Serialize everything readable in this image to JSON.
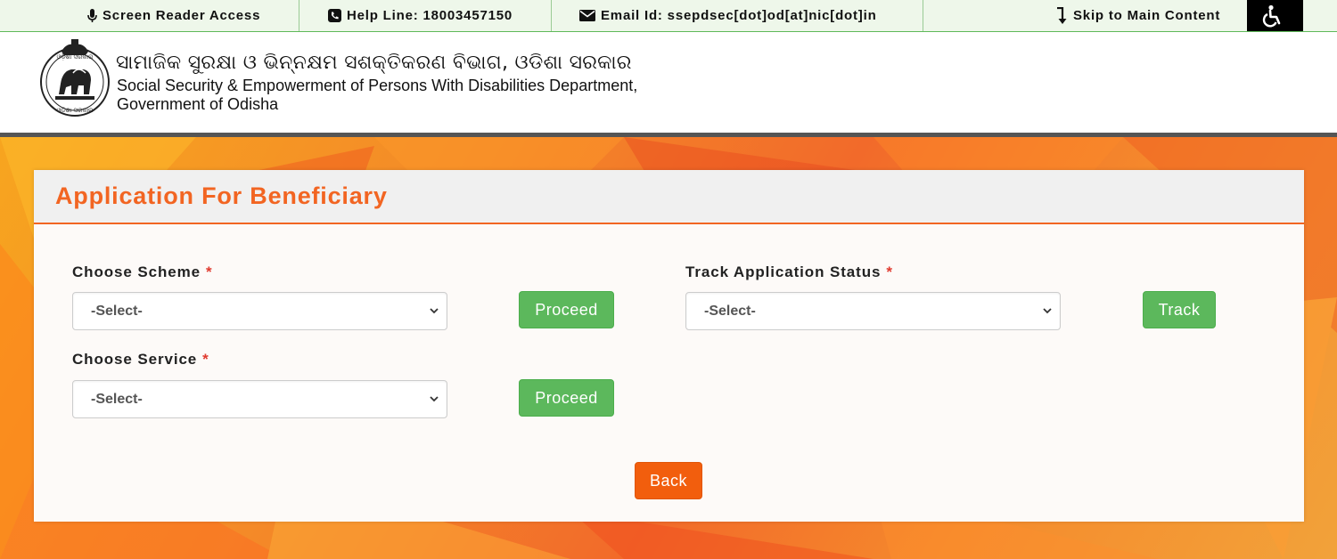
{
  "topbar": {
    "screen_reader": "Screen Reader Access",
    "helpline": "Help Line: 18003457150",
    "email": "Email Id: ssepdsec[dot]od[at]nic[dot]in",
    "skip": "Skip to Main Content",
    "icons": {
      "screen_reader": "microphone-icon",
      "helpline": "phone-icon",
      "email": "envelope-icon",
      "skip": "down-arrow-icon",
      "accessibility": "wheelchair-icon"
    }
  },
  "header": {
    "title_odia": "ସାମାଜିକ ସୁରକ୍ଷା ଓ ଭିନ୍ନକ୍ଷମ ସଶକ୍ତିକରଣ ବିଭାଗ, ଓଡିଶା  ସରକାର",
    "title_en_line1": "Social Security & Empowerment of Persons With Disabilities Department,",
    "title_en_line2": "Government of Odisha",
    "emblem_top_text": "ଓଡ଼ିଶା ସରକାର",
    "emblem_bottom_text": "ଓଡ଼ିଶା ସରକାର"
  },
  "panel": {
    "title": "Application For Beneficiary",
    "choose_scheme": {
      "label": "Choose Scheme",
      "required": "*",
      "value": "-Select-",
      "button": "Proceed"
    },
    "choose_service": {
      "label": "Choose Service",
      "required": "*",
      "value": "-Select-",
      "button": "Proceed"
    },
    "track_status": {
      "label": "Track Application Status",
      "required": "*",
      "value": "-Select-",
      "button": "Track"
    },
    "back_button": "Back"
  },
  "colors": {
    "accent_orange": "#f26522",
    "green_button": "#5cb85c",
    "back_button": "#f25e0d",
    "topbar_bg": "#eef7ea"
  }
}
